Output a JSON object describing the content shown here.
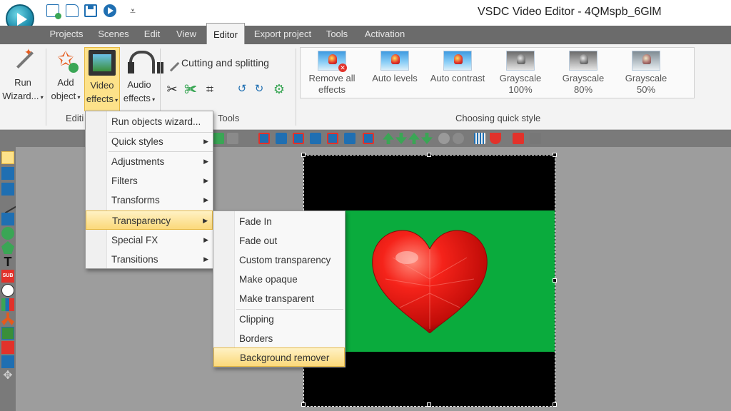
{
  "window": {
    "title": "VSDC Video Editor - 4QMspb_6GlM"
  },
  "menu_tabs": [
    {
      "label": "Projects"
    },
    {
      "label": "Scenes"
    },
    {
      "label": "Edit"
    },
    {
      "label": "View"
    },
    {
      "label": "Editor",
      "active": true
    },
    {
      "label": "Export project"
    },
    {
      "label": "Tools"
    },
    {
      "label": "Activation"
    }
  ],
  "ribbon": {
    "run_wizard": {
      "line1": "Run",
      "line2": "Wizard..."
    },
    "add_object": {
      "line1": "Add",
      "line2": "object"
    },
    "video_effects": {
      "line1": "Video",
      "line2": "effects"
    },
    "audio_effects": {
      "line1": "Audio",
      "line2": "effects"
    },
    "editing_group_label": "Editi",
    "tools_group_label": "Tools",
    "cutting_label": "Cutting and splitting",
    "quick_style_group_label": "Choosing quick style",
    "quick_styles": [
      {
        "line1": "Remove all",
        "line2": "effects"
      },
      {
        "line1": "Auto levels",
        "line2": ""
      },
      {
        "line1": "Auto contrast",
        "line2": ""
      },
      {
        "line1": "Grayscale",
        "line2": "100%"
      },
      {
        "line1": "Grayscale 80%",
        "line2": ""
      },
      {
        "line1": "Grayscale 50%",
        "line2": ""
      }
    ]
  },
  "video_effects_menu": [
    {
      "label": "Run objects wizard..."
    },
    {
      "label": "Quick styles",
      "submenu": true
    },
    {
      "label": "Adjustments",
      "submenu": true
    },
    {
      "label": "Filters",
      "submenu": true
    },
    {
      "label": "Transforms",
      "submenu": true
    },
    {
      "label": "Transparency",
      "submenu": true,
      "highlighted": true
    },
    {
      "label": "Special FX",
      "submenu": true
    },
    {
      "label": "Transitions",
      "submenu": true
    }
  ],
  "transparency_submenu": [
    {
      "label": "Fade In"
    },
    {
      "label": "Fade out"
    },
    {
      "label": "Custom transparency"
    },
    {
      "label": "Make opaque"
    },
    {
      "label": "Make transparent"
    },
    {
      "label": "Clipping"
    },
    {
      "label": "Borders"
    },
    {
      "label": "Background remover",
      "highlighted": true
    }
  ],
  "colors": {
    "accent_highlight": "#fbd97a",
    "menubar": "#6b6b6b",
    "preview_green": "#0aab3d",
    "heart_red": "#e3130f"
  }
}
